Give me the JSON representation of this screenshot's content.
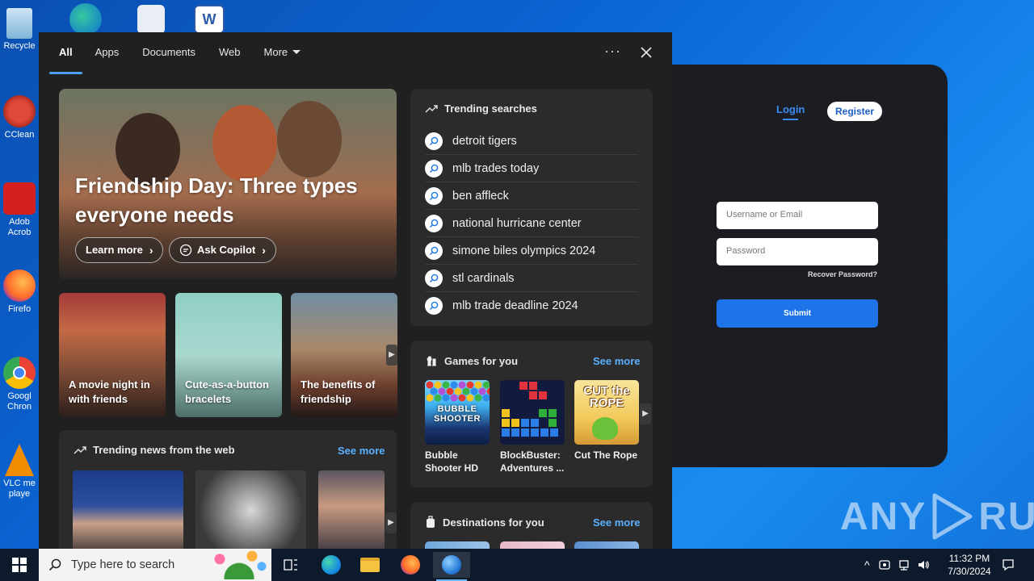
{
  "desktop": {
    "icons": [
      {
        "label": "Recycle",
        "icon": "recycle-bin-icon"
      },
      {
        "label": "CClean",
        "icon": "ccleaner-icon"
      },
      {
        "label": "Adob Acrob",
        "icon": "acrobat-icon"
      },
      {
        "label": "Firefo",
        "icon": "firefox-icon"
      },
      {
        "label": "Googl Chron",
        "icon": "chrome-icon"
      },
      {
        "label": "VLC me playe",
        "icon": "vlc-icon"
      }
    ]
  },
  "login": {
    "tab_login": "Login",
    "tab_register": "Register",
    "username_placeholder": "Username or Email",
    "password_placeholder": "Password",
    "recover": "Recover Password?",
    "submit": "Submit"
  },
  "watermark": {
    "left": "ANY",
    "right": "RUN"
  },
  "search": {
    "tabs": [
      "All",
      "Apps",
      "Documents",
      "Web",
      "More"
    ],
    "ellipsis": "···",
    "hero": {
      "title": "Friendship Day: Three types everyone needs",
      "learn_more": "Learn more",
      "ask_copilot": "Ask Copilot"
    },
    "cards": [
      {
        "caption": "A movie night in with friends"
      },
      {
        "caption": "Cute-as-a-button bracelets"
      },
      {
        "caption": "The benefits of friendship"
      }
    ],
    "news": {
      "title": "Trending news from the web",
      "see_more": "See more"
    },
    "trending": {
      "title": "Trending searches",
      "items": [
        "detroit tigers",
        "mlb trades today",
        "ben affleck",
        "national hurricane center",
        "simone biles olympics 2024",
        "stl cardinals",
        "mlb trade deadline 2024"
      ]
    },
    "games": {
      "title": "Games for you",
      "see_more": "See more",
      "items": [
        {
          "name": "Bubble Shooter HD",
          "tile_text": "BUBBLE SHOOTER"
        },
        {
          "name": "BlockBuster: Adventures ...",
          "tile_text": ""
        },
        {
          "name": "Cut The Rope",
          "tile_text": "CUT the ROPE"
        }
      ]
    },
    "destinations": {
      "title": "Destinations for you",
      "see_more": "See more"
    }
  },
  "taskbar": {
    "search_placeholder": "Type here to search",
    "time": "11:32 PM",
    "date": "7/30/2024"
  },
  "colors": {
    "accent": "#4ca0f5",
    "link": "#5ab0ff",
    "flyout_bg": "#202020",
    "card_bg": "#2b2b2b"
  }
}
